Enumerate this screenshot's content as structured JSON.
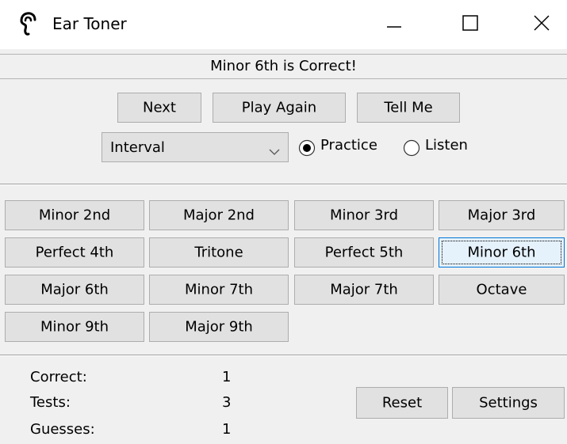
{
  "window": {
    "title": "Ear Toner",
    "icon": "ear-icon",
    "controls": [
      "minimize-icon",
      "maximize-icon",
      "close-icon"
    ]
  },
  "status": {
    "message": "Minor 6th is Correct!"
  },
  "controls": {
    "next": "Next",
    "play_again": "Play Again",
    "tell_me": "Tell Me",
    "mode_select": {
      "value": "Interval"
    },
    "practice": "Practice",
    "listen": "Listen",
    "selected_mode": "Practice"
  },
  "intervals": [
    "Minor 2nd",
    "Major 2nd",
    "Minor 3rd",
    "Major 3rd",
    "Perfect 4th",
    "Tritone",
    "Perfect 5th",
    "Minor 6th",
    "Major 6th",
    "Minor 7th",
    "Major 7th",
    "Octave",
    "Minor 9th",
    "Major 9th"
  ],
  "selected_interval": "Minor 6th",
  "stats": {
    "correct_label": "Correct:",
    "correct_value": "1",
    "tests_label": "Tests:",
    "tests_value": "3",
    "guesses_label": "Guesses:",
    "guesses_value": "1"
  },
  "actions": {
    "reset": "Reset",
    "settings": "Settings"
  },
  "colors": {
    "button_face": "#e1e1e1",
    "selected_border": "#0078d7",
    "window_bg": "#f0f0f0"
  }
}
